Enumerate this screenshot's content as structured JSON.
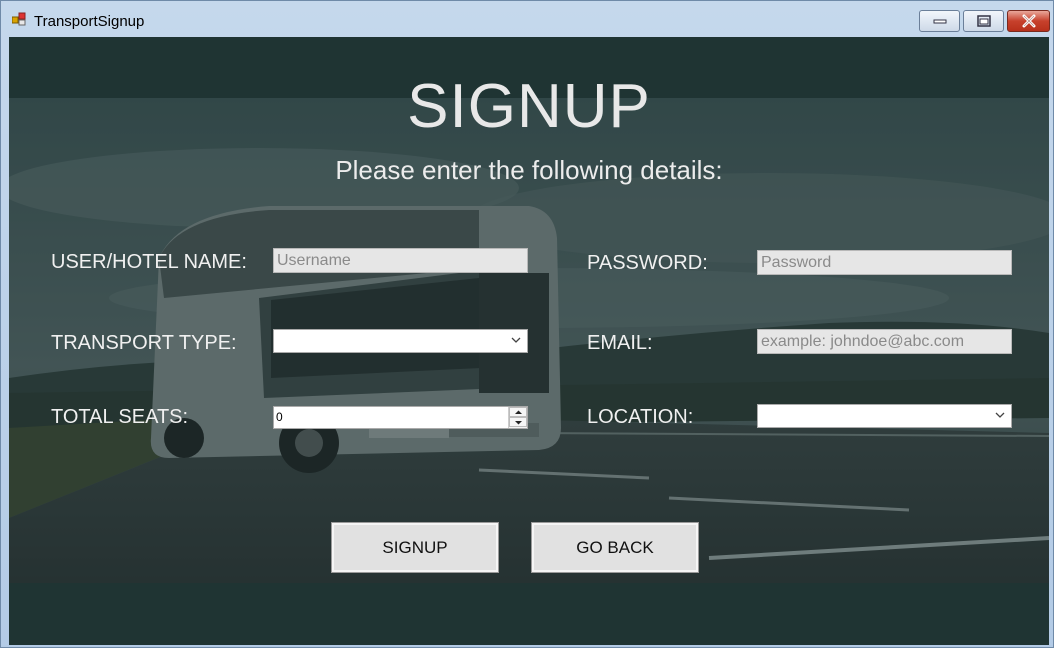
{
  "window": {
    "title": "TransportSignup",
    "controls": {
      "minimize": "minimize",
      "maximize": "maximize",
      "close": "close"
    }
  },
  "form": {
    "heading": "SIGNUP",
    "subheading": "Please enter the following details:",
    "fields": {
      "username": {
        "label": "USER/HOTEL NAME:",
        "placeholder": "Username",
        "value": ""
      },
      "password": {
        "label": "PASSWORD:",
        "placeholder": "Password",
        "value": ""
      },
      "transport_type": {
        "label": "TRANSPORT TYPE:",
        "value": ""
      },
      "email": {
        "label": "EMAIL:",
        "placeholder": "example: johndoe@abc.com",
        "value": ""
      },
      "total_seats": {
        "label": "TOTAL SEATS:",
        "value": "0"
      },
      "location": {
        "label": "LOCATION:",
        "value": ""
      }
    },
    "buttons": {
      "signup": "SIGNUP",
      "go_back": "GO BACK"
    }
  },
  "icons": [
    "app-icon",
    "minimize-icon",
    "maximize-icon",
    "close-icon",
    "chevron-down-icon",
    "spin-up-icon",
    "spin-down-icon"
  ],
  "colors": {
    "background": "#1f3433",
    "text": "#f0f0f0",
    "input_bg": "#e6e6e6",
    "close_button": "#c7412c"
  }
}
